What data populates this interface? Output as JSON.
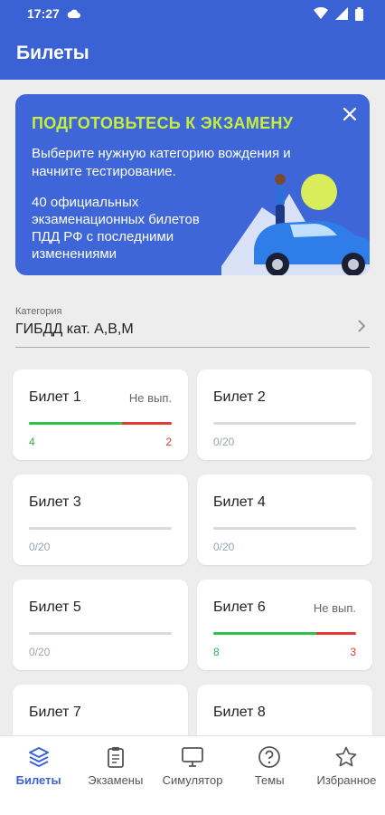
{
  "status": {
    "time": "17:27"
  },
  "app_bar": {
    "title": "Билеты"
  },
  "banner": {
    "title": "ПОДГОТОВЬТЕСЬ К ЭКЗАМЕНУ",
    "text1": "Выберите нужную категорию вождения и начните тестирование.",
    "text2": "40 официальных экзаменационных билетов ПДД РФ с последними изменениями"
  },
  "category": {
    "label": "Категория",
    "value": "ГИБДД кат. А,В,М"
  },
  "tickets": [
    {
      "name": "Билет 1",
      "status": "Не вып.",
      "correct": "4",
      "wrong": "2",
      "progress_correct": 0.65,
      "progress_wrong": 0.35
    },
    {
      "name": "Билет 2",
      "status": "",
      "correct": "0/20",
      "wrong": "",
      "progress_correct": 0,
      "progress_wrong": 0
    },
    {
      "name": "Билет 3",
      "status": "",
      "correct": "0/20",
      "wrong": "",
      "progress_correct": 0,
      "progress_wrong": 0
    },
    {
      "name": "Билет 4",
      "status": "",
      "correct": "0/20",
      "wrong": "",
      "progress_correct": 0,
      "progress_wrong": 0
    },
    {
      "name": "Билет 5",
      "status": "",
      "correct": "0/20",
      "wrong": "",
      "progress_correct": 0,
      "progress_wrong": 0
    },
    {
      "name": "Билет 6",
      "status": "Не вып.",
      "correct": "8",
      "wrong": "3",
      "progress_correct": 0.72,
      "progress_wrong": 0.28
    },
    {
      "name": "Билет 7",
      "status": "",
      "correct": "",
      "wrong": "",
      "progress_correct": 0,
      "progress_wrong": 0
    },
    {
      "name": "Билет 8",
      "status": "",
      "correct": "",
      "wrong": "",
      "progress_correct": 0,
      "progress_wrong": 0
    }
  ],
  "nav": [
    {
      "label": "Билеты",
      "icon": "layers-icon"
    },
    {
      "label": "Экзамены",
      "icon": "clipboard-icon"
    },
    {
      "label": "Симулятор",
      "icon": "monitor-icon"
    },
    {
      "label": "Темы",
      "icon": "question-icon"
    },
    {
      "label": "Избранное",
      "icon": "star-icon"
    }
  ],
  "colors": {
    "primary": "#3a62d4",
    "accent_title": "#c6ee3a",
    "correct": "#2fc24a",
    "wrong": "#e53935"
  }
}
